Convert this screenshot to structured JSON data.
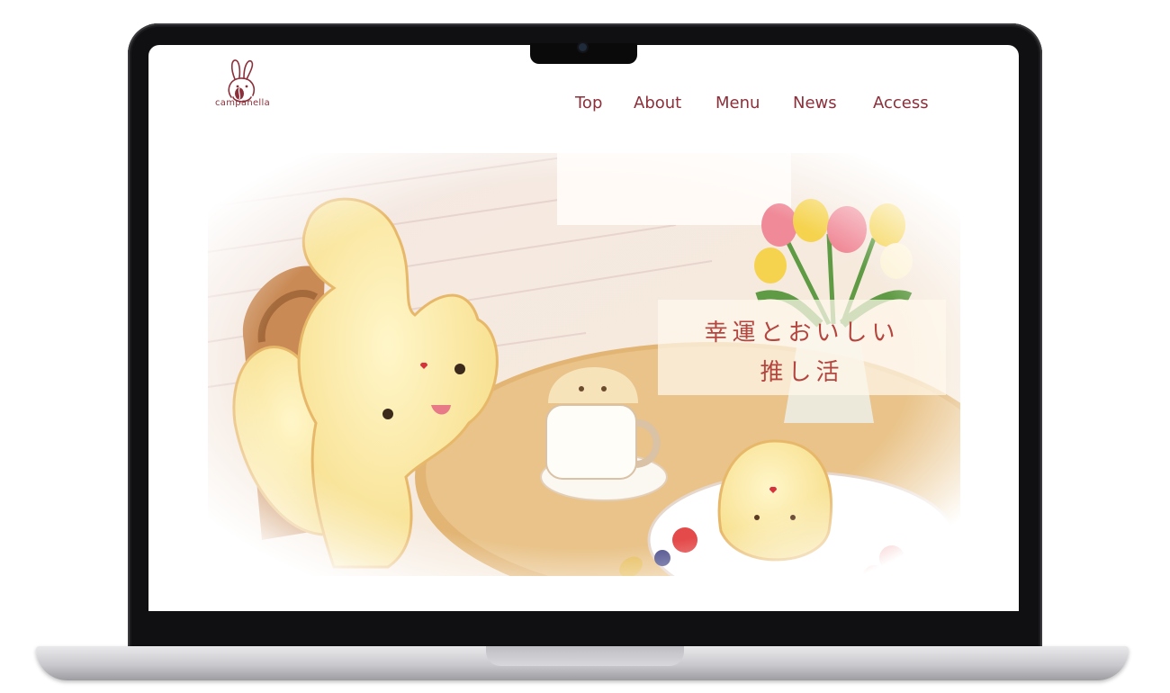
{
  "site": {
    "logo_text": "campanella"
  },
  "nav": {
    "items": [
      {
        "label": "Top"
      },
      {
        "label": "About"
      },
      {
        "label": "Menu"
      },
      {
        "label": "News"
      },
      {
        "label": "Access"
      }
    ]
  },
  "hero": {
    "tagline_line1": "幸運とおいしい",
    "tagline_line2": "推し活"
  },
  "colors": {
    "brand": "#8c2f3a",
    "tagline": "#b4463f",
    "background": "#ffffff"
  }
}
